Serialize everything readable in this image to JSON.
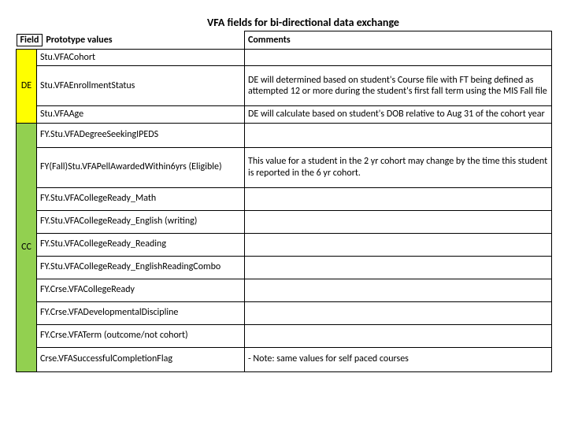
{
  "title": "VFA fields for bi-directional data exchange",
  "header": {
    "field": "Field",
    "proto": "Prototype values",
    "comments": "Comments"
  },
  "labels": {
    "de": "DE",
    "cc": "CC"
  },
  "rows": [
    {
      "f": "Stu.VFACohort",
      "c": ""
    },
    {
      "f": "Stu.VFAEnrollmentStatus",
      "c": "DE will determined based on student's Course file with FT being defined as attempted 12 or more during the student's first fall term using the MIS Fall file"
    },
    {
      "f": "Stu.VFAAge",
      "c": "DE will calculate based on student's DOB relative to Aug 31 of the cohort year"
    },
    {
      "f": "FY.Stu.VFADegreeSeekingIPEDS",
      "c": ""
    },
    {
      "f": "FY(Fall)Stu.VFAPellAwardedWithin6yrs (Eligible)",
      "c": "This value for a student in the 2 yr cohort may change by the time this student is reported in the 6 yr cohort."
    },
    {
      "f": "FY.Stu.VFACollegeReady_Math",
      "c": ""
    },
    {
      "f": "FY.Stu.VFACollegeReady_English (writing)",
      "c": ""
    },
    {
      "f": "FY.Stu.VFACollegeReady_Reading",
      "c": ""
    },
    {
      "f": "FY.Stu.VFACollegeReady_EnglishReadingCombo",
      "c": ""
    },
    {
      "f": "FY.Crse.VFACollegeReady",
      "c": ""
    },
    {
      "f": "FY.Crse.VFADevelopmentalDiscipline",
      "c": ""
    },
    {
      "f": "FY.Crse.VFATerm (outcome/not cohort)",
      "c": ""
    },
    {
      "f": "Crse.VFASuccessfulCompletionFlag",
      "c": "- Note:  same values for self paced courses"
    }
  ]
}
